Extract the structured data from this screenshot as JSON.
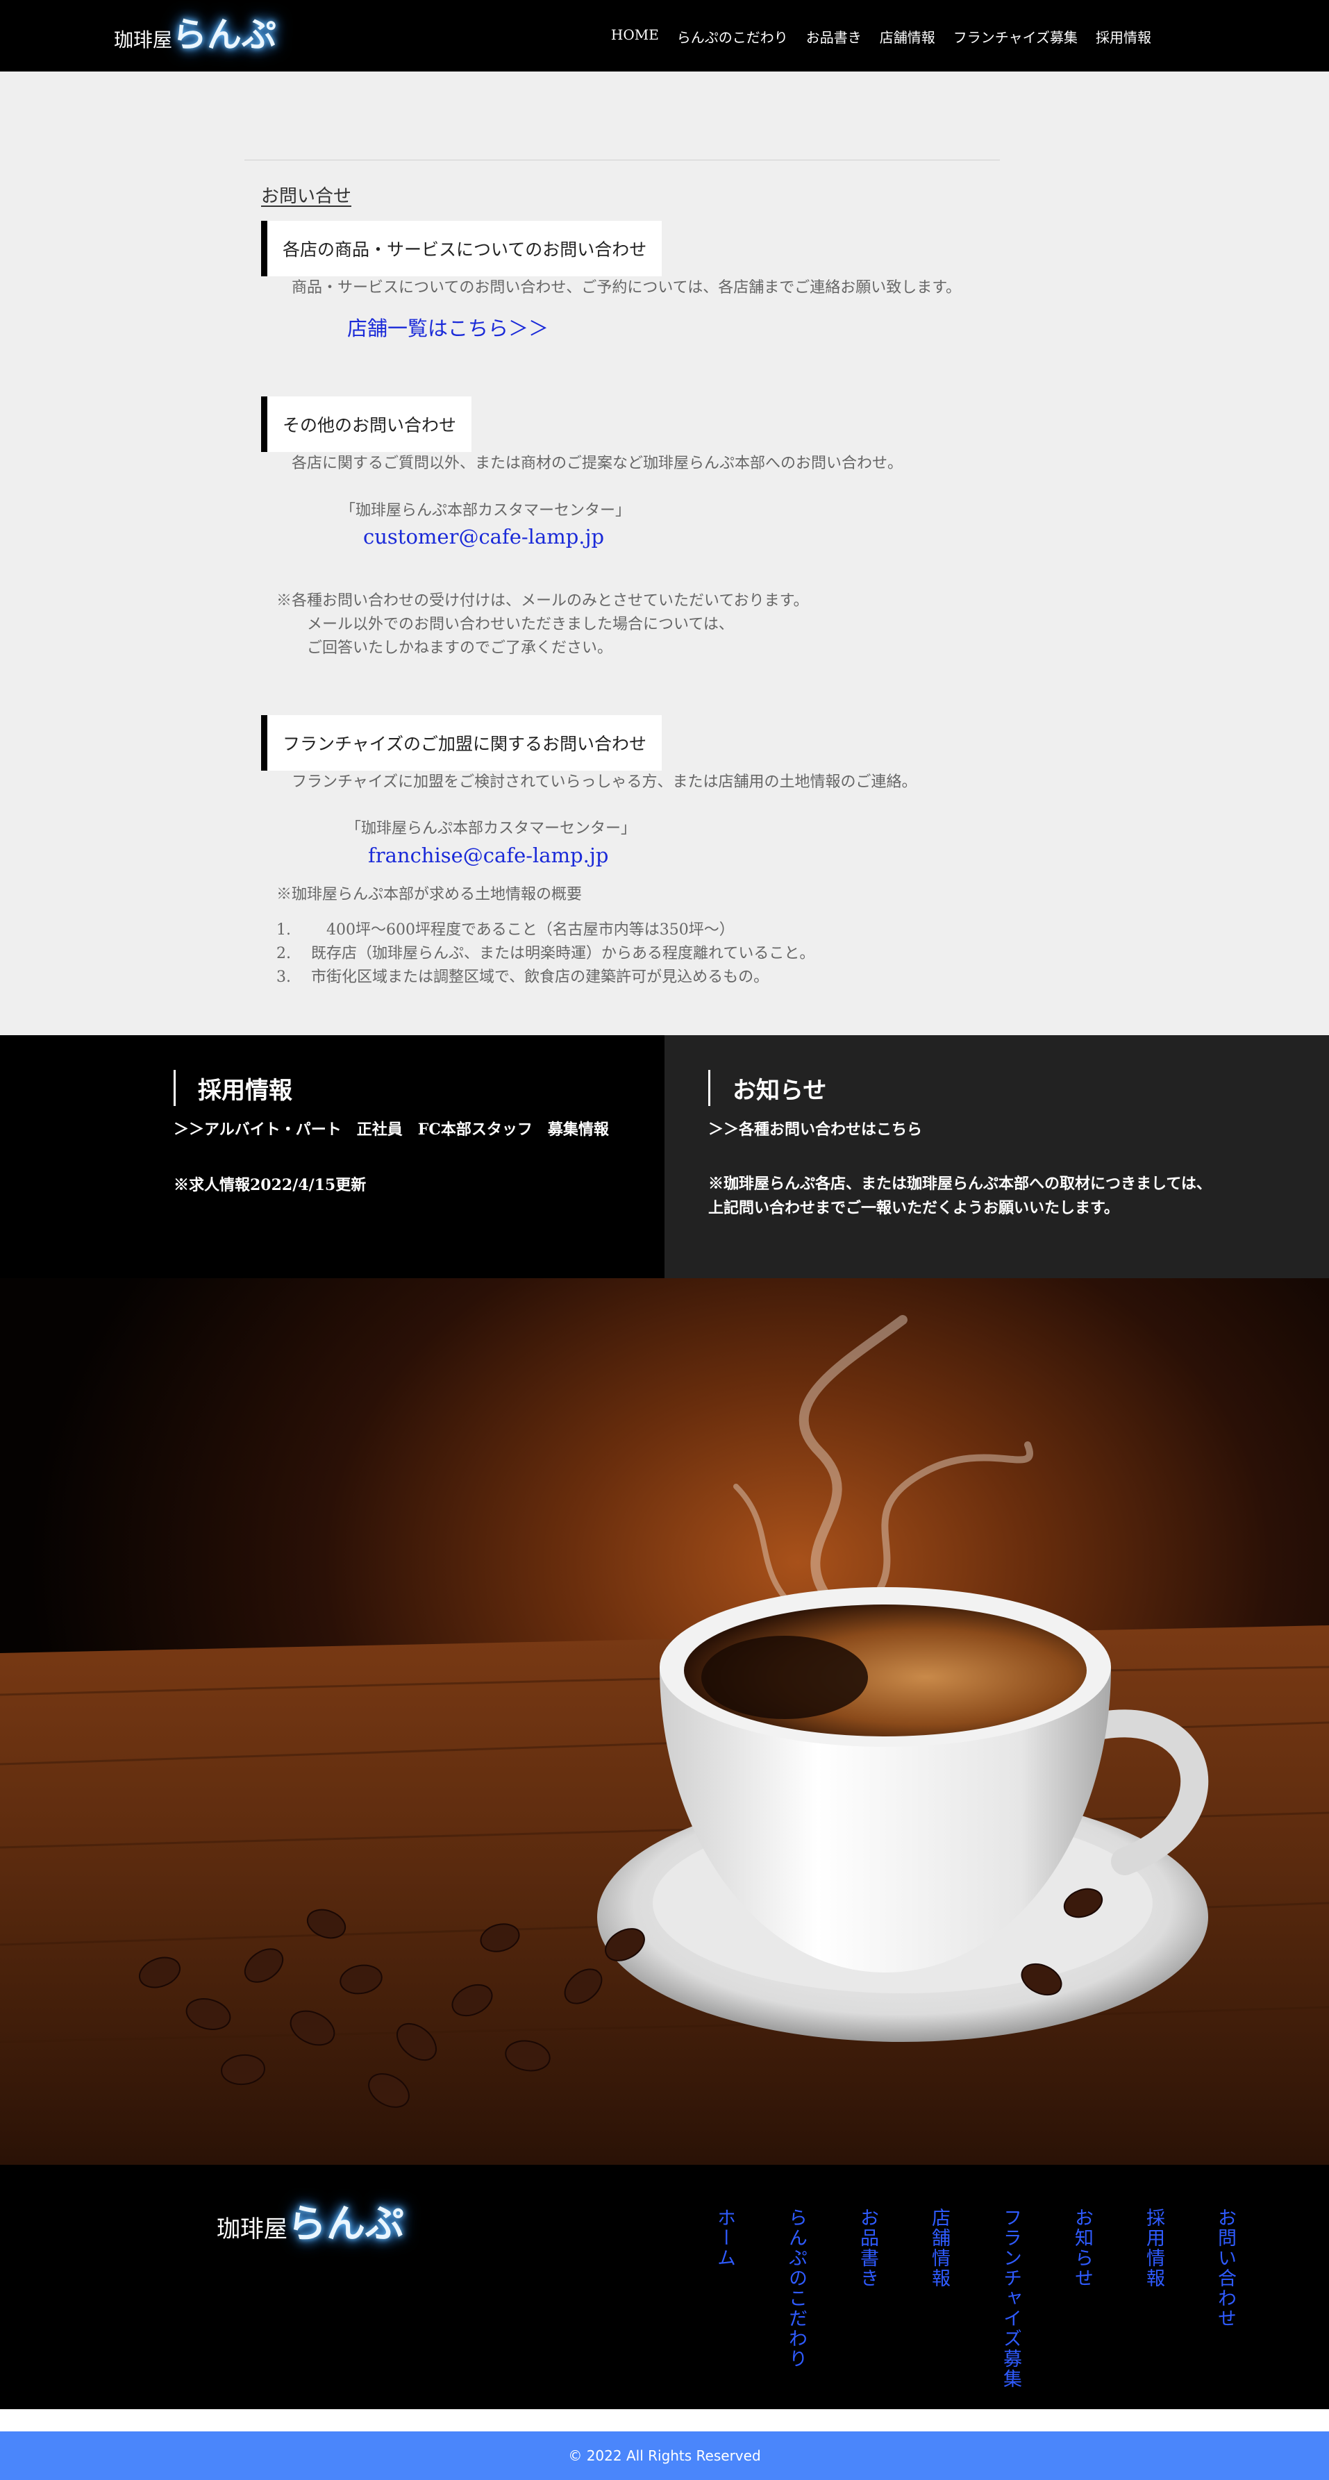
{
  "header": {
    "logo_small": "珈琲屋",
    "logo_big": "らんぷ",
    "nav": [
      "HOME",
      "らんぷのこだわり",
      "お品書き",
      "店舗情報",
      "フランチャイズ募集",
      "採用情報"
    ]
  },
  "main": {
    "page_title": "お問い合せ",
    "section1": {
      "heading": "各店の商品・サービスについてのお問い合わせ",
      "text": "商品・サービスについてのお問い合わせ、ご予約については、各店舗までご連絡お願い致します。",
      "link": "店舗一覧はこちら＞＞"
    },
    "section2": {
      "heading": "その他のお問い合わせ",
      "text": "各店に関するご質問以外、または商材のご提案など珈琲屋らんぷ本部へのお問い合わせ。",
      "center_name": "「珈琲屋らんぷ本部カスタマーセンター」",
      "email": "customer@cafe-lamp.jp",
      "notice": [
        "※各種お問い合わせの受け付けは、メールのみとさせていただいております。",
        "メール以外でのお問い合わせいただきました場合については、",
        "ご回答いたしかねますのでご了承ください。"
      ]
    },
    "section3": {
      "heading": "フランチャイズのご加盟に関するお問い合わせ",
      "text": "フランチャイズに加盟をご検討されていらっしゃる方、または店舗用の土地情報のご連絡。",
      "center_name": "「珈琲屋らんぷ本部カスタマーセンター」",
      "email": "franchise@cafe-lamp.jp",
      "land_title": "※珈琲屋らんぷ本部が求める土地情報の概要",
      "conditions": [
        {
          "num": "1.",
          "text": "　400坪～600坪程度であること（名古屋市内等は350坪～）"
        },
        {
          "num": "2.",
          "text": "既存店（珈琲屋らんぷ、または明楽時運）からある程度離れていること。"
        },
        {
          "num": "3.",
          "text": "市街化区域または調整区域で、飲食店の建築許可が見込めるもの。"
        }
      ]
    }
  },
  "info": {
    "recruit": {
      "title": "採用情報",
      "link": "＞＞アルバイト・パート　正社員　FC本部スタッフ　募集情報",
      "note": "※求人情報2022/4/15更新"
    },
    "news": {
      "title": "お知らせ",
      "link": "＞＞各種お問い合わせはこちら",
      "text": [
        "※珈琲屋らんぷ各店、または珈琲屋らんぷ本部への取材につきましては、",
        "上記問い合わせまでご一報いただくようお願いいたします。"
      ]
    }
  },
  "footer": {
    "logo_small": "珈琲屋",
    "logo_big": "らんぷ",
    "nav": [
      "ホーム",
      "らんぷのこだわり",
      "お品書き",
      "店舗情報",
      "フランチャイズ募集",
      "お知らせ",
      "採用情報",
      "お問い合わせ"
    ],
    "copyright": "© 2022 All Rights Reserved"
  },
  "colors": {
    "header_bg": "#000000",
    "page_bg": "#efefef",
    "link_blue": "#1a2ad8",
    "footer_nav_blue": "#2f5bff",
    "copyright_bar": "#4a86fb",
    "info_right_bg": "#222222"
  }
}
